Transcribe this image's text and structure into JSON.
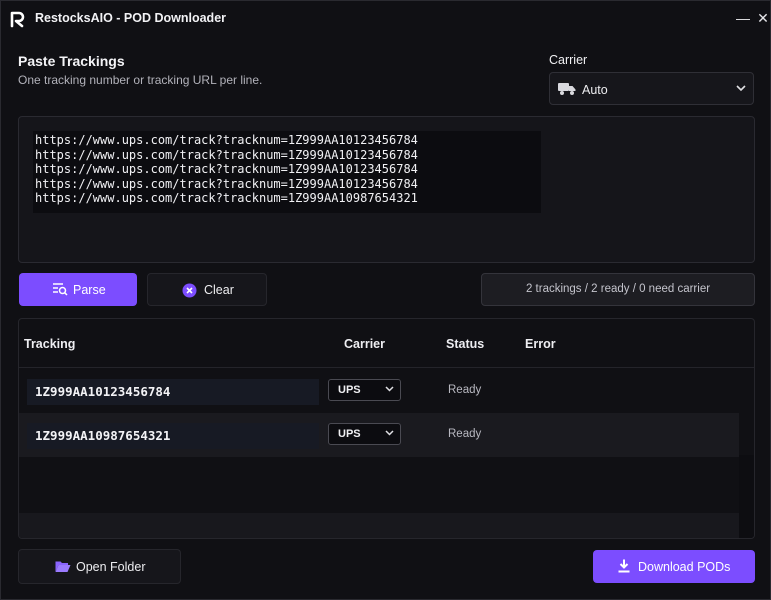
{
  "window": {
    "title": "RestocksAIO - POD Downloader",
    "minimize_glyph": "—",
    "close_glyph": "✕"
  },
  "header": {
    "title": "Paste Trackings",
    "subtitle": "One tracking number or tracking URL per line."
  },
  "carrier": {
    "label": "Carrier",
    "selected": "Auto",
    "icon": "truck-icon"
  },
  "input": {
    "text": "https://www.ups.com/track?tracknum=1Z999AA10123456784\nhttps://www.ups.com/track?tracknum=1Z999AA10123456784\nhttps://www.ups.com/track?tracknum=1Z999AA10123456784\nhttps://www.ups.com/track?tracknum=1Z999AA10123456784\nhttps://www.ups.com/track?tracknum=1Z999AA10987654321"
  },
  "actions": {
    "parse_label": "Parse",
    "clear_label": "Clear"
  },
  "summary": "2 trackings / 2 ready / 0 need carrier",
  "table": {
    "columns": {
      "tracking": "Tracking",
      "carrier": "Carrier",
      "status": "Status",
      "error": "Error"
    },
    "rows": [
      {
        "tracking": "1Z999AA10123456784",
        "carrier": "UPS",
        "status": "Ready",
        "error": ""
      },
      {
        "tracking": "1Z999AA10987654321",
        "carrier": "UPS",
        "status": "Ready",
        "error": ""
      }
    ]
  },
  "footer": {
    "open_folder_label": "Open Folder",
    "download_label": "Download PODs"
  },
  "colors": {
    "accent": "#7c4dff",
    "background": "#101014",
    "panel": "#15151a"
  }
}
